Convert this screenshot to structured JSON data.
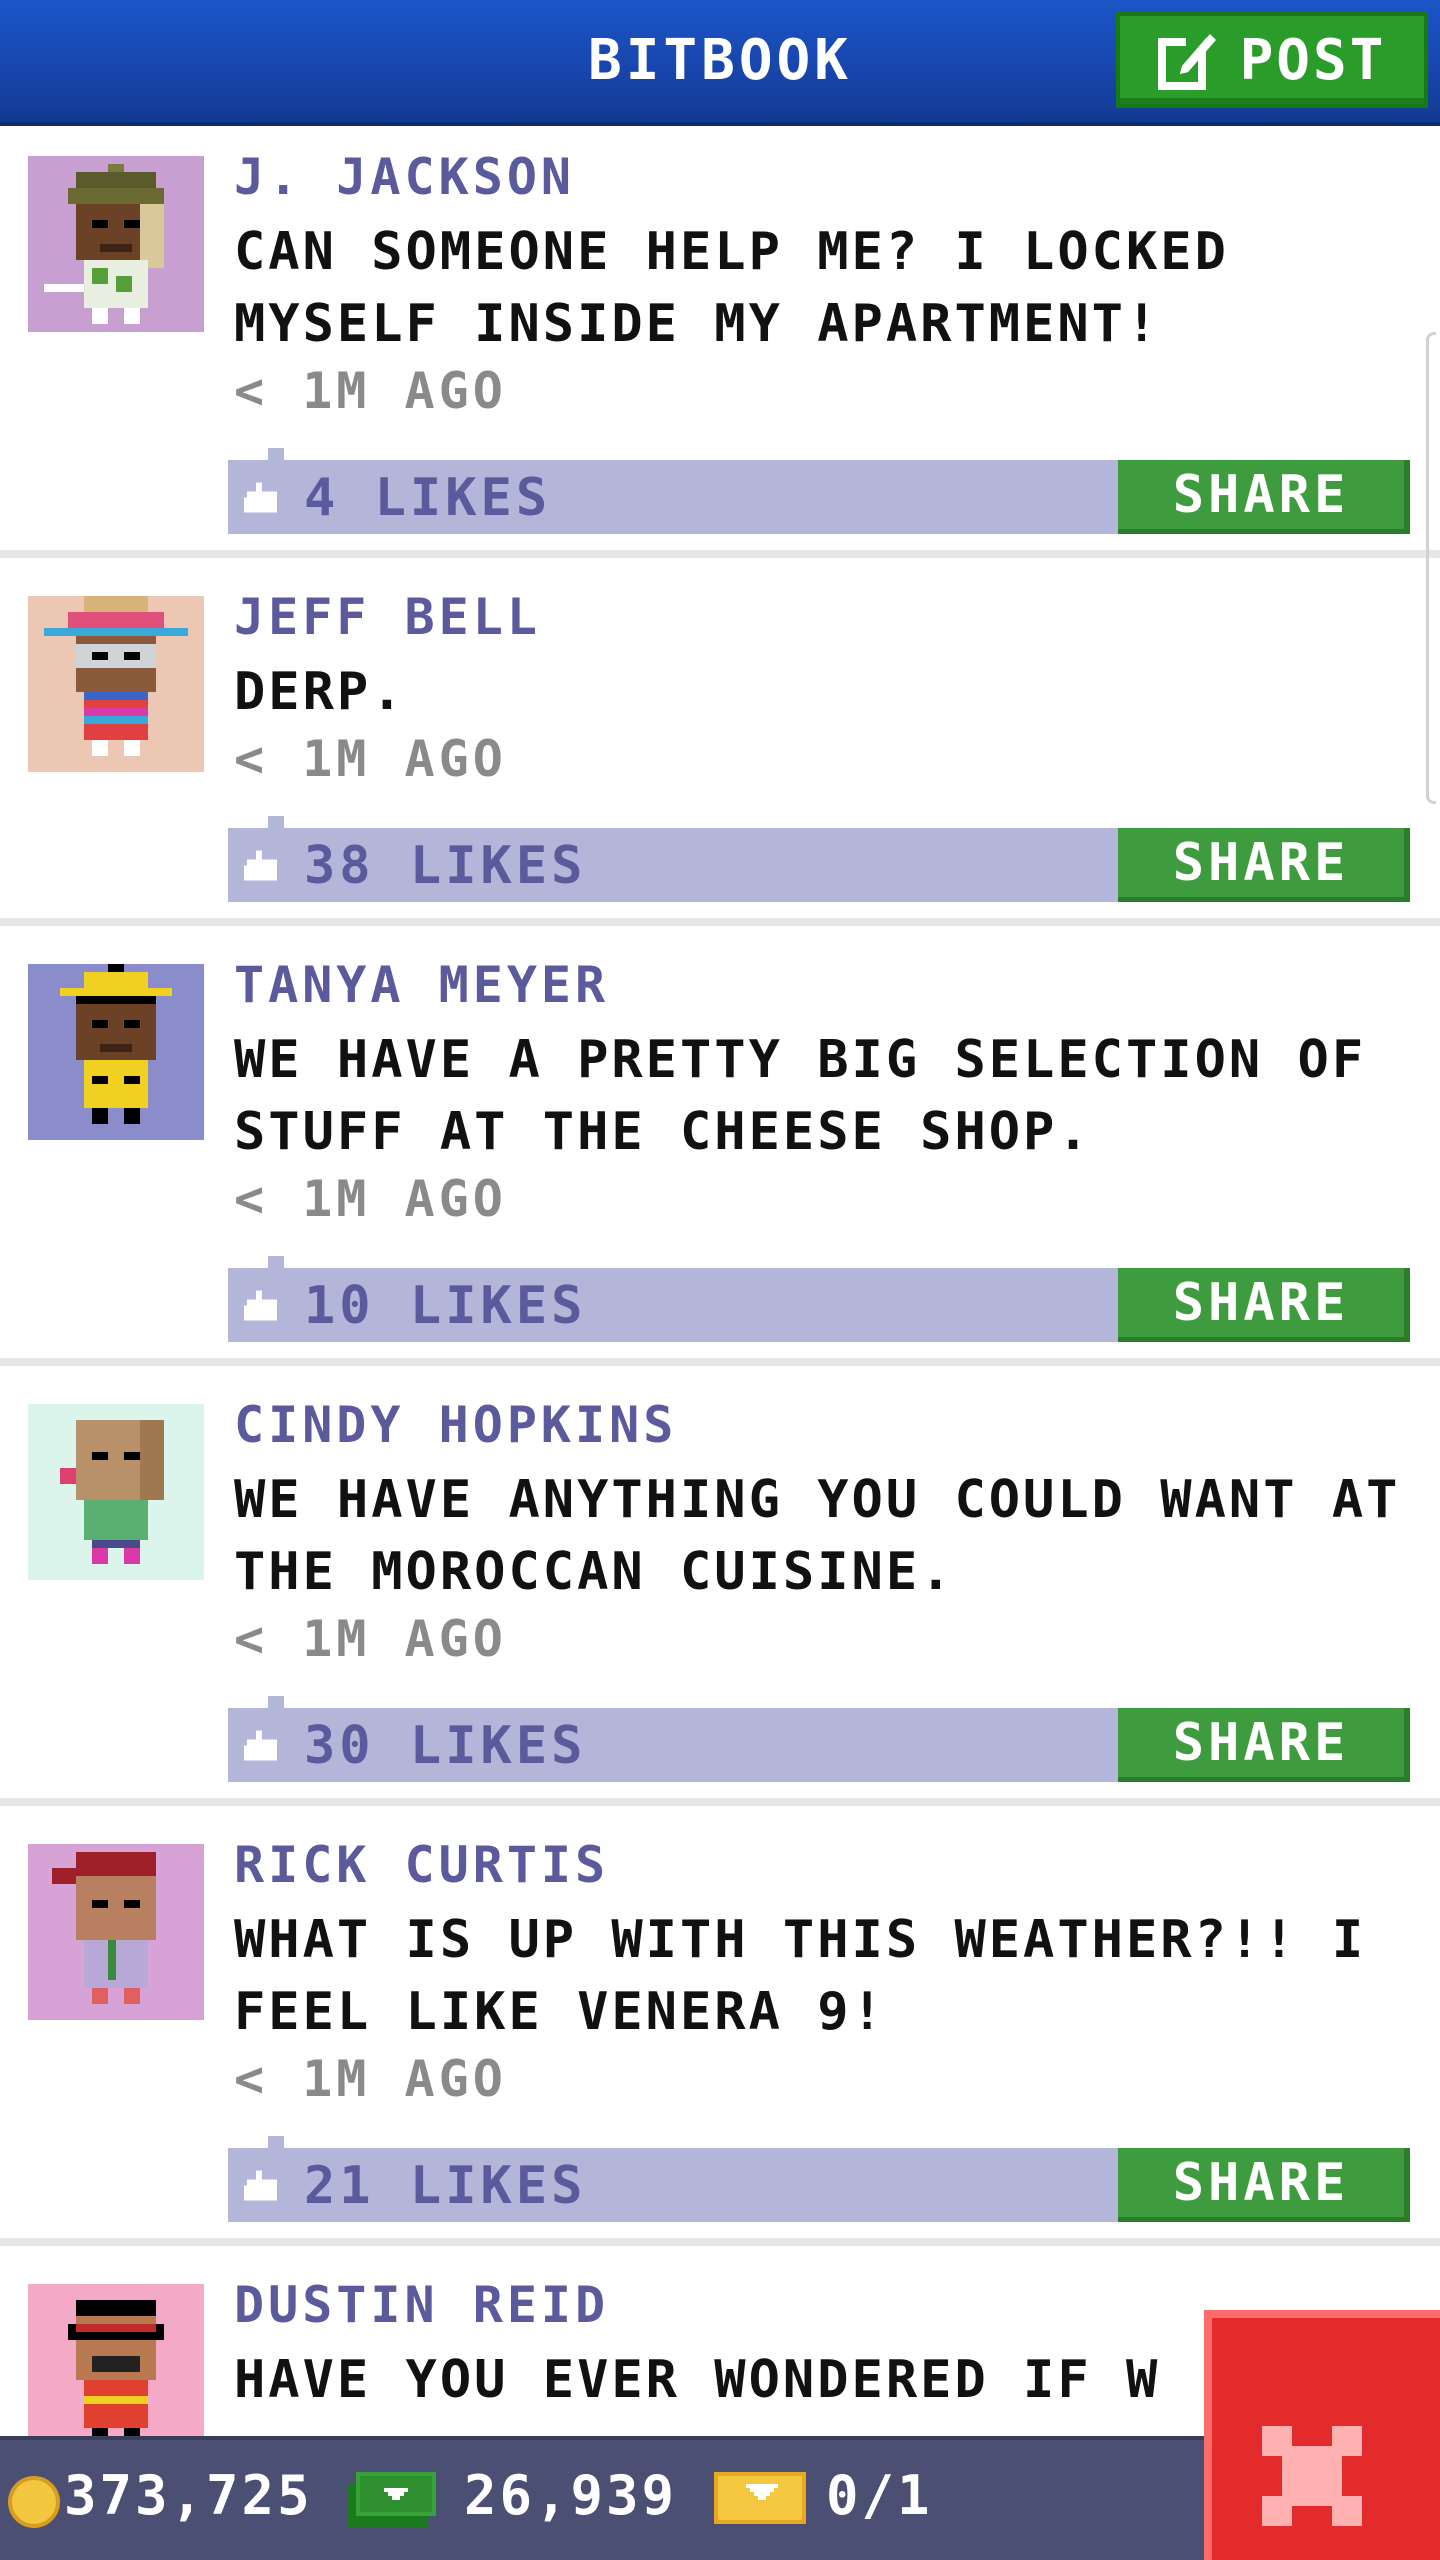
{
  "header": {
    "title": "BITBOOK",
    "post_label": "POST"
  },
  "posts": [
    {
      "author": "J. JACKSON",
      "message": "CAN SOMEONE HELP ME? I LOCKED MYSELF INSIDE MY APARTMENT!",
      "time": "< 1M AGO",
      "likes": "4 LIKES",
      "share_label": "SHARE",
      "avatar_bg": "#c7a0d1"
    },
    {
      "author": "JEFF BELL",
      "message": "DERP.",
      "time": "< 1M AGO",
      "likes": "38 LIKES",
      "share_label": "SHARE",
      "avatar_bg": "#ecc8b4"
    },
    {
      "author": "TANYA MEYER",
      "message": "WE HAVE A PRETTY BIG SELECTION OF STUFF AT THE CHEESE SHOP.",
      "time": "< 1M AGO",
      "likes": "10 LIKES",
      "share_label": "SHARE",
      "avatar_bg": "#8a8ccc"
    },
    {
      "author": "CINDY HOPKINS",
      "message": "WE HAVE ANYTHING YOU COULD WANT AT THE MOROCCAN CUISINE.",
      "time": "< 1M AGO",
      "likes": "30 LIKES",
      "share_label": "SHARE",
      "avatar_bg": "#dcf5ec"
    },
    {
      "author": "RICK CURTIS",
      "message": "WHAT IS UP WITH THIS WEATHER?!! I FEEL LIKE VENERA 9!",
      "time": "< 1M AGO",
      "likes": "21 LIKES",
      "share_label": "SHARE",
      "avatar_bg": "#d7a3d6"
    },
    {
      "author": "DUSTIN REID",
      "message": "HAVE YOU EVER WONDERED IF W",
      "time": "",
      "likes": "",
      "share_label": "",
      "avatar_bg": "#f4a9c6"
    }
  ],
  "status_bar": {
    "coins": "373,725",
    "bux": "26,939",
    "tickets": "0/1"
  },
  "colors": {
    "header": "#1846ad",
    "post_green": "#2a9c2a",
    "share_green": "#3e9c3e",
    "likes_bar": "#b3b6d8",
    "author_text": "#5a5a9c",
    "bottom_bar": "#4c4f74",
    "close_red": "#e32b2b"
  },
  "icons": {
    "post": "edit-icon",
    "like": "thumbs-up-icon",
    "coin": "coin-icon",
    "bux": "bux-icon",
    "ticket": "ticket-icon",
    "close": "close-icon"
  }
}
